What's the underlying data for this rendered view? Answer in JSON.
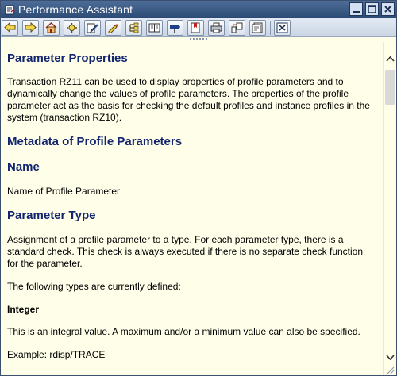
{
  "window": {
    "title": "Performance Assistant"
  },
  "toolbar": {
    "buttons": [
      {
        "icon": "back-arrow-icon"
      },
      {
        "icon": "forward-arrow-icon"
      },
      {
        "icon": "home-icon"
      },
      {
        "icon": "technical-info-icon"
      },
      {
        "icon": "edit-icon"
      },
      {
        "icon": "highlight-icon"
      },
      {
        "icon": "hierarchy-icon"
      },
      {
        "icon": "book-icon"
      },
      {
        "icon": "signpost-icon"
      },
      {
        "icon": "bookmark-icon"
      },
      {
        "icon": "print-icon"
      },
      {
        "icon": "structure-icon"
      },
      {
        "icon": "page-view-icon"
      },
      {
        "icon": "close-icon"
      }
    ]
  },
  "content": {
    "heading_parameter_properties": "Parameter Properties",
    "intro": "Transaction RZ11 can be used to display properties of profile parameters and to dynamically change the values of profile parameters. The properties of the profile parameter act as the basis for checking the default profiles and instance profiles in the system (transaction RZ10).",
    "heading_metadata": "Metadata of Profile Parameters",
    "heading_name": "Name",
    "name_text": "Name of Profile Parameter",
    "heading_type": "Parameter Type",
    "type_text": "Assignment of a profile parameter to a type. For each parameter type, there is a standard check. This check is always executed if there is no separate check function for the parameter.",
    "types_defined": "The following types are currently defined:",
    "heading_integer": "Integer",
    "integer_text": "This is an integral value. A maximum and/or a minimum value can also be specified.",
    "example": "Example: rdisp/TRACE"
  }
}
